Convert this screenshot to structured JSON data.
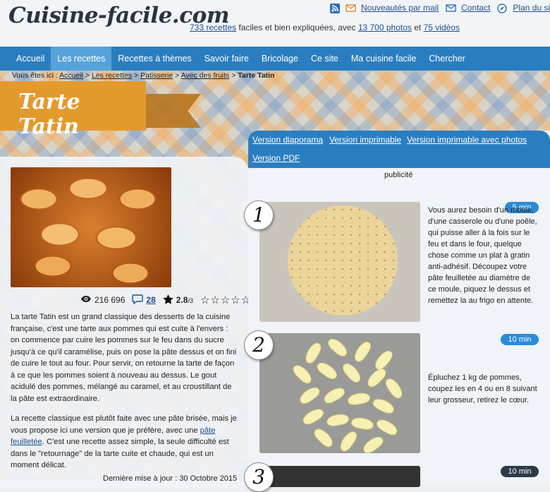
{
  "header": {
    "logo": "Cuisine-facile.com",
    "tagline": {
      "recipes_link": "733 recettes",
      "text1": " faciles et bien expliquées, avec ",
      "photos_link": "13 700 photos",
      "text2": " et ",
      "videos_link": "75 vidéos"
    },
    "top_links": {
      "newsletter": "Nouveautés par mail",
      "contact": "Contact",
      "sitemap": "Plan du site"
    }
  },
  "nav": [
    "Accueil",
    "Les recettes",
    "Recettes à thèmes",
    "Savoir faire",
    "Bricolage",
    "Ce site",
    "Ma cuisine facile",
    "Chercher"
  ],
  "nav_active": "Les recettes",
  "breadcrumb": {
    "prefix": "Vous êtes ici : ",
    "items": [
      "Accueil",
      "Les recettes",
      "Patisserie",
      "Avec des fruits"
    ],
    "sep": " > ",
    "current": "Tarte Tatin"
  },
  "title": "Tarte Tatin",
  "stats": {
    "views": "216 696",
    "comments": "28",
    "rating": "2.8",
    "rating_max": "/3",
    "stars_display": "☆☆☆☆☆"
  },
  "intro": {
    "p1": "La tarte Tatin est un grand classique des desserts de la cuisine française, c'est une tarte aux pommes qui est cuite à l'envers : on commence par cuire les pommes sur le feu dans du sucre jusqu'à ce qu'il caramélise, puis on pose la pâte dessus et on fini de cuire le tout au four. Pour servir, on retourne la tarte de façon à ce que les pommes soient à nouveau au dessus. Le gout acidulé des pommes, mélangé au caramel, et au croustillant de la pâte est extraordinaire.",
    "p2_before": "La recette classique est plutôt faite avec une pâte brisée, mais je vous propose ici une version que je préfère, avec une ",
    "p2_link": "pâte feuilletée",
    "p2_after": ". C'est une recette assez simple, la seule difficulté est dans le \"retournage\" de la tarte cuite et chaude, qui est un moment délicat.",
    "last_update": "Dernière mise à jour : 30 Octobre 2015"
  },
  "versions": [
    "Version diaporama",
    "Version imprimable",
    "Version imprimable avec photos",
    "Version PDF"
  ],
  "advert_label": "publicité",
  "steps": [
    {
      "num": "1",
      "duration": "5 min",
      "text": "Vous aurez besoin d'un moule, d'une casserole ou d'une poêle, qui puisse aller à la fois sur le feu et dans le four, quelque chose comme un plat à gratin anti-adhésif. Découpez votre pâte feuilletée au diamètre de ce moule, piquez le dessus et remettez la au frigo en attente."
    },
    {
      "num": "2",
      "duration": "10 min",
      "text": "Épluchez 1 kg de pommes, coupez les en 4 ou en 8 suivant leur grosseur, retirez le cœur."
    },
    {
      "num": "3",
      "duration": "10 min",
      "text": ""
    }
  ]
}
